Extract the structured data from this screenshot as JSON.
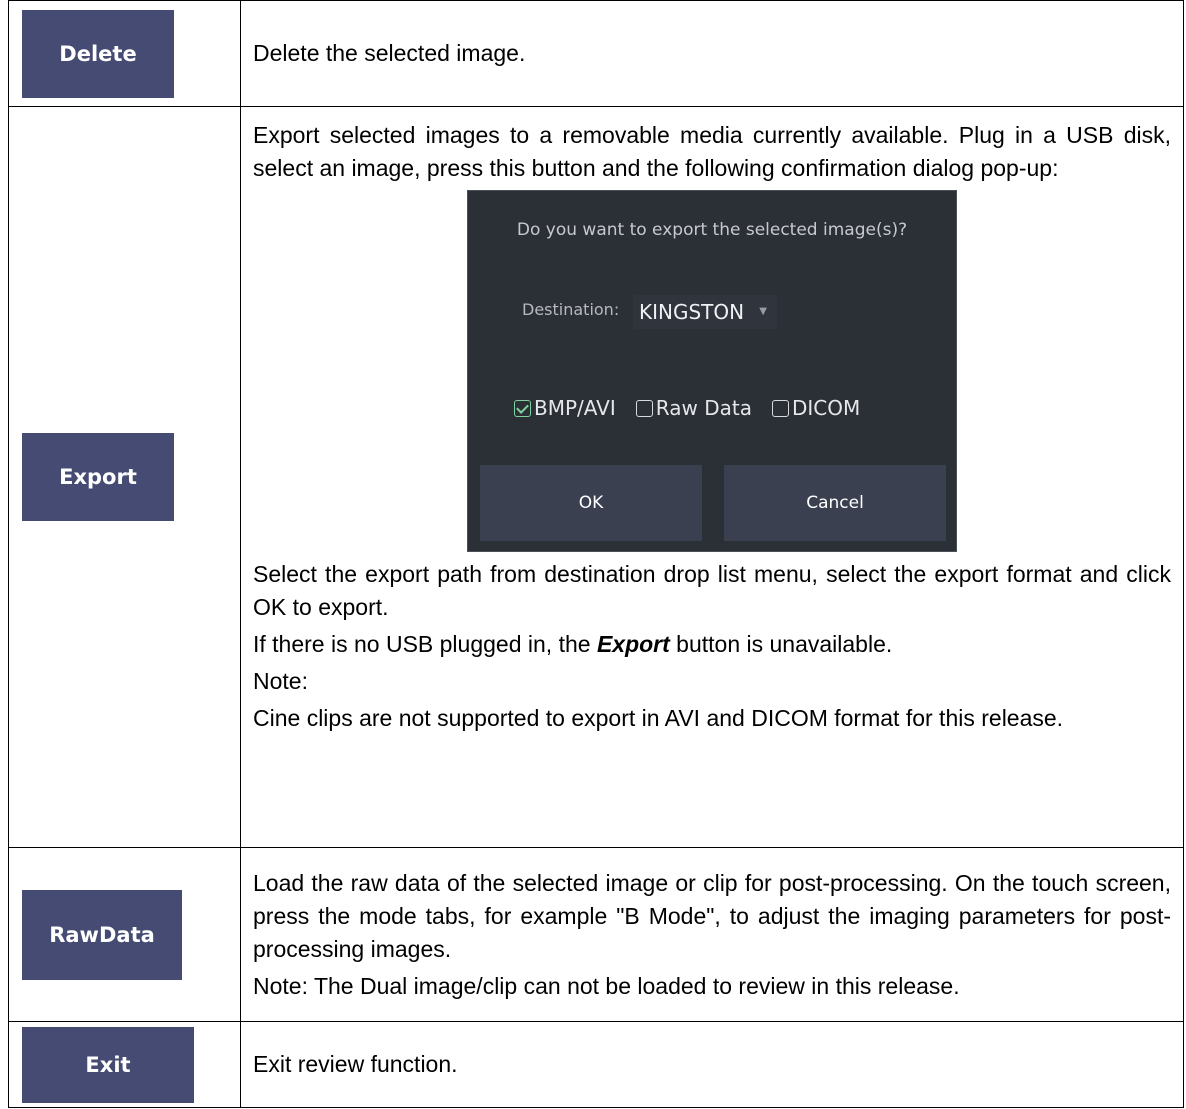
{
  "rows": [
    {
      "button_label": "Delete",
      "description": "Delete the selected image."
    },
    {
      "button_label": "Export",
      "intro": "Export selected images to a removable media currently available. Plug in a USB disk, select an image, press this button and the following confirmation dialog pop-up:",
      "dialog": {
        "question": "Do you want to export the selected image(s)?",
        "destination_label": "Destination:",
        "destination_value": "KINGSTON",
        "options": [
          {
            "label": "BMP/AVI",
            "checked": true
          },
          {
            "label": "Raw Data",
            "checked": false
          },
          {
            "label": "DICOM",
            "checked": false
          }
        ],
        "ok_label": "OK",
        "cancel_label": "Cancel",
        "colors": {
          "background": "#2b2f36",
          "button": "#3a4050",
          "checkbox_checked": "#7fd29c"
        }
      },
      "after_dialog": "Select the export path from destination drop list menu, select the export format and click OK to export.",
      "no_usb_prefix": "If there is no USB plugged in, the ",
      "no_usb_emphasis": "Export",
      "no_usb_suffix": " button is unavailable.",
      "note_label": "Note:",
      "note_text": "Cine clips are not supported to export in AVI and DICOM format for this release."
    },
    {
      "button_label": "RawData",
      "description": "Load the raw data of the selected image or clip for post-processing. On the touch screen, press the mode tabs, for example \"B Mode\", to adjust the imaging parameters for post-processing images.",
      "note": "Note: The Dual image/clip can not be loaded to review in this release."
    },
    {
      "button_label": "Exit",
      "description": "Exit review function."
    }
  ],
  "colors": {
    "button_background": "#454b72",
    "button_text": "#ffffff"
  }
}
